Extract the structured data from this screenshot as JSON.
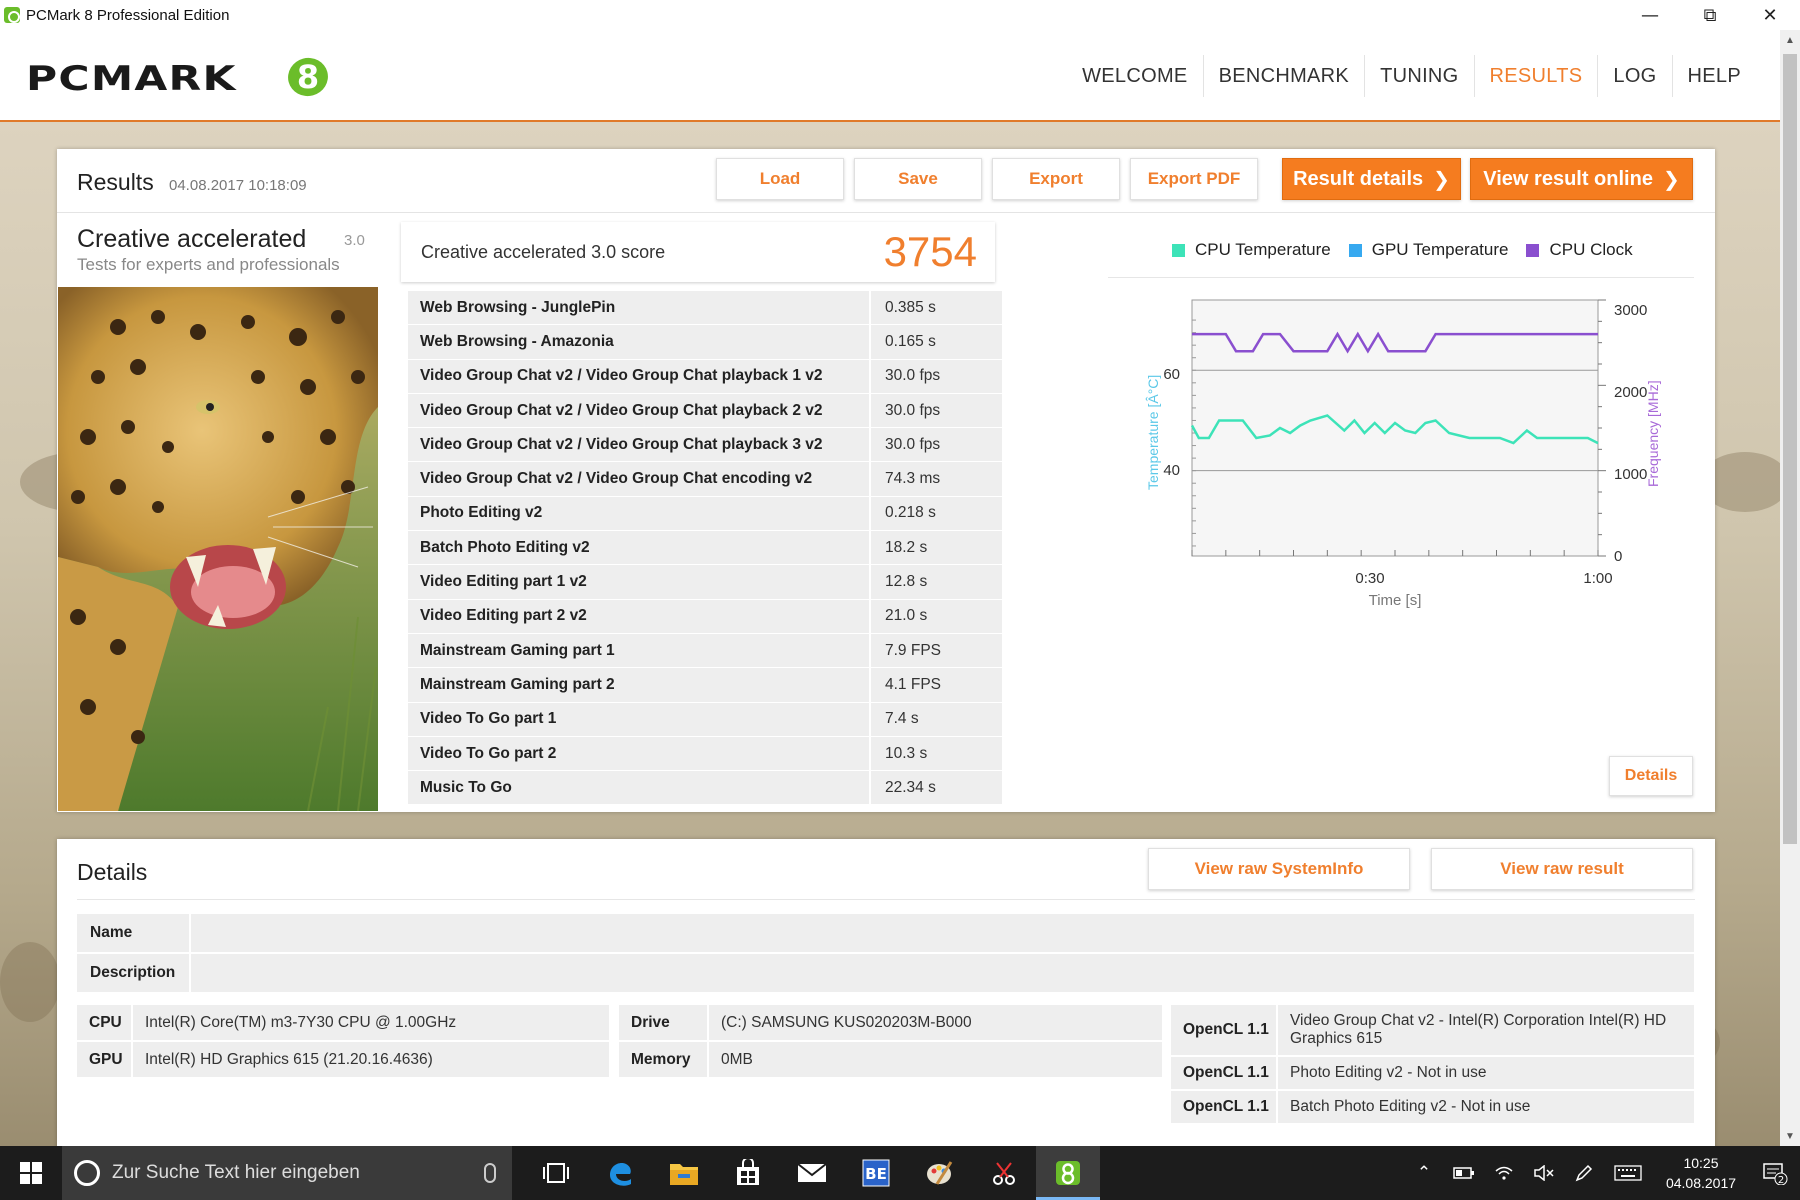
{
  "window": {
    "title": "PCMark 8 Professional Edition",
    "controls": [
      "minimize-icon",
      "maximize-icon",
      "close-icon"
    ]
  },
  "header": {
    "logo_text": "PCMARK",
    "logo_number": "8",
    "nav": [
      {
        "label": "WELCOME",
        "active": false
      },
      {
        "label": "BENCHMARK",
        "active": false
      },
      {
        "label": "TUNING",
        "active": false
      },
      {
        "label": "RESULTS",
        "active": true
      },
      {
        "label": "LOG",
        "active": false
      },
      {
        "label": "HELP",
        "active": false
      }
    ]
  },
  "colors": {
    "accent": "#f07f2e",
    "button_orange": "#f57c1f",
    "cpu_temp": "#3de3b8",
    "gpu_temp": "#36a9f0",
    "cpu_clock": "#8a4fcf"
  },
  "results": {
    "title": "Results",
    "date": "04.08.2017 10:18:09",
    "buttons": {
      "load": "Load",
      "save": "Save",
      "export": "Export",
      "export_pdf": "Export PDF",
      "result_details": "Result details",
      "view_online": "View result online"
    },
    "test": {
      "name": "Creative accelerated",
      "version": "3.0",
      "subtitle": "Tests for experts and professionals"
    },
    "score": {
      "label": "Creative accelerated 3.0 score",
      "value": "3754"
    },
    "rows": [
      {
        "name": "Web Browsing - JunglePin",
        "value": "0.385 s"
      },
      {
        "name": "Web Browsing - Amazonia",
        "value": "0.165 s"
      },
      {
        "name": "Video Group Chat v2 / Video Group Chat playback 1 v2",
        "value": "30.0 fps"
      },
      {
        "name": "Video Group Chat v2 / Video Group Chat playback 2 v2",
        "value": "30.0 fps"
      },
      {
        "name": "Video Group Chat v2 / Video Group Chat playback 3 v2",
        "value": "30.0 fps"
      },
      {
        "name": "Video Group Chat v2 / Video Group Chat encoding v2",
        "value": "74.3 ms"
      },
      {
        "name": "Photo Editing v2",
        "value": "0.218 s"
      },
      {
        "name": "Batch Photo Editing v2",
        "value": "18.2 s"
      },
      {
        "name": "Video Editing part 1 v2",
        "value": "12.8 s"
      },
      {
        "name": "Video Editing part 2 v2",
        "value": "21.0 s"
      },
      {
        "name": "Mainstream Gaming part 1",
        "value": "7.9 FPS"
      },
      {
        "name": "Mainstream Gaming part 2",
        "value": "4.1 FPS"
      },
      {
        "name": "Video To Go part 1",
        "value": "7.4 s"
      },
      {
        "name": "Video To Go part 2",
        "value": "10.3 s"
      },
      {
        "name": "Music To Go",
        "value": "22.34 s"
      }
    ],
    "details_button": "Details"
  },
  "chart_data": {
    "type": "line",
    "legend": [
      "CPU Temperature",
      "GPU Temperature",
      "CPU Clock"
    ],
    "xlabel": "Time [s]",
    "ylabel_left": "Temperature [Â°C]",
    "ylabel_right": "Frequency [MHz]",
    "x_ticks": [
      "0:30",
      "1:00"
    ],
    "y_left_ticks": [
      "60",
      "40"
    ],
    "y_right_ticks": [
      "3000",
      "2000",
      "1000",
      "0"
    ],
    "xlim": [
      0,
      60
    ],
    "ylim_left": [
      23,
      74
    ],
    "ylim_right": [
      0,
      3000
    ],
    "series": [
      {
        "name": "CPU Temperature",
        "axis": "left",
        "x": [
          0,
          1,
          2.5,
          4,
          6,
          7.5,
          9.5,
          11.5,
          13,
          14.5,
          16,
          17.5,
          20,
          22.5,
          24,
          25.5,
          27,
          28.5,
          30,
          31.5,
          33,
          34.5,
          36,
          38,
          39.5,
          41,
          42.5,
          44,
          45.5,
          47.5,
          49.5,
          51,
          53,
          55,
          57,
          58.5,
          60
        ],
        "y": [
          49,
          46.5,
          46.5,
          50,
          50,
          50,
          46.5,
          47,
          48.5,
          47.5,
          49,
          50,
          51,
          48,
          50,
          47.5,
          49.5,
          47.5,
          49.5,
          48,
          47.5,
          49.5,
          50,
          47.5,
          47,
          46.5,
          46.5,
          46.5,
          46.5,
          45.5,
          48,
          46.5,
          46.5,
          46.5,
          46.5,
          46.5,
          45.5
        ]
      },
      {
        "name": "CPU Clock",
        "axis": "right",
        "x": [
          0,
          5,
          6.5,
          9,
          10.5,
          13,
          15,
          18,
          20,
          21.5,
          23,
          24.5,
          26,
          27.5,
          29,
          31,
          32.5,
          34.5,
          36,
          38,
          40,
          60
        ],
        "y": [
          2600,
          2600,
          2400,
          2400,
          2600,
          2600,
          2400,
          2400,
          2400,
          2600,
          2400,
          2600,
          2400,
          2600,
          2400,
          2400,
          2400,
          2400,
          2600,
          2600,
          2600,
          2600
        ]
      }
    ]
  },
  "details": {
    "title": "Details",
    "buttons": {
      "view_systeminfo": "View raw SystemInfo",
      "view_result": "View raw result"
    },
    "name_label": "Name",
    "name_value": "",
    "description_label": "Description",
    "description_value": "",
    "system_left": [
      {
        "key": "CPU",
        "value": "Intel(R) Core(TM) m3-7Y30 CPU @ 1.00GHz"
      },
      {
        "key": "GPU",
        "value": "Intel(R) HD Graphics 615 (21.20.16.4636)"
      }
    ],
    "system_mid": [
      {
        "key": "Drive",
        "value": "(C:) SAMSUNG KUS020203M-B000"
      },
      {
        "key": "Memory",
        "value": "0MB"
      }
    ],
    "opencl": [
      {
        "key": "OpenCL 1.1",
        "value": "Video Group Chat v2 - Intel(R) Corporation Intel(R) HD Graphics 615"
      },
      {
        "key": "OpenCL 1.1",
        "value": "Photo Editing v2 - Not in use"
      },
      {
        "key": "OpenCL 1.1",
        "value": "Batch Photo Editing v2 - Not in use"
      }
    ]
  },
  "taskbar": {
    "search_placeholder": "Zur Suche Text hier eingeben",
    "time": "10:25",
    "date": "04.08.2017",
    "notification_count": "2"
  }
}
